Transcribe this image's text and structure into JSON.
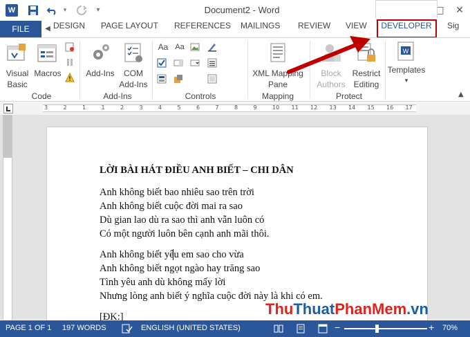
{
  "titlebar": {
    "app_icon_letter": "W",
    "title": "Document2 - Word",
    "help_label": "?",
    "restore_ribbon_label": "↑",
    "minimize_label": "—",
    "maximize_label": "□",
    "close_label": "✕"
  },
  "tabs": {
    "file": "FILE",
    "items": [
      "DESIGN",
      "PAGE LAYOUT",
      "REFERENCES",
      "MAILINGS",
      "REVIEW",
      "VIEW"
    ],
    "active": "DEVELOPER",
    "overflow": "Sig"
  },
  "ribbon": {
    "code": {
      "visual_basic_label_1": "Visual",
      "visual_basic_label_2": "Basic",
      "macros_label": "Macros",
      "group_label": "Code"
    },
    "addins": {
      "addins_label": "Add-Ins",
      "com_label_1": "COM",
      "com_label_2": "Add-Ins",
      "group_label": "Add-Ins"
    },
    "controls": {
      "group_label": "Controls",
      "aa1": "Aa",
      "aa2": "Aa"
    },
    "mapping": {
      "xml_label_1": "XML Mapping",
      "xml_label_2": "Pane",
      "group_label": "Mapping"
    },
    "protect": {
      "block_label_1": "Block",
      "block_label_2": "Authors",
      "restrict_label_1": "Restrict",
      "restrict_label_2": "Editing",
      "group_label": "Protect"
    },
    "templates": {
      "templates_label": "Templates"
    }
  },
  "ruler": {
    "numbers": [
      "3",
      "2",
      "1",
      "1",
      "2",
      "3",
      "4",
      "5",
      "6",
      "7",
      "8",
      "9",
      "10",
      "11",
      "12",
      "13",
      "14",
      "15",
      "16",
      "17"
    ]
  },
  "document": {
    "title": "LỜI BÀI HÁT ĐIỀU ANH BIẾT – CHI DÂN",
    "lines": [
      "Anh không biết bao nhiêu sao trên trời",
      "Anh không biết cuộc đời mai ra sao",
      "Dù gian lao dù ra sao thì anh vẫn luôn có",
      "Có một người luôn bên cạnh anh mãi thôi.",
      "Anh không biết yêu em sao cho vừa",
      "Anh không biết ngọt ngào hay trăng sao",
      "Tình yêu anh dù không mấy lời",
      "Nhưng lòng anh biết ý nghĩa cuộc đời này là khi có em.",
      "[ĐK:]"
    ]
  },
  "watermark": {
    "part1": "Thu",
    "part2": "Thuat",
    "part3": "PhanMem",
    "part4": ".vn"
  },
  "statusbar": {
    "page": "PAGE 1 OF 1",
    "words": "197 WORDS",
    "language": "ENGLISH (UNITED STATES)",
    "zoom": "70%",
    "zoom_minus": "−",
    "zoom_plus": "+"
  },
  "colors": {
    "accent": "#2b579a",
    "highlight_red": "#c00000",
    "watermark_red": "#e0231c",
    "watermark_blue": "#1a5ea8"
  }
}
